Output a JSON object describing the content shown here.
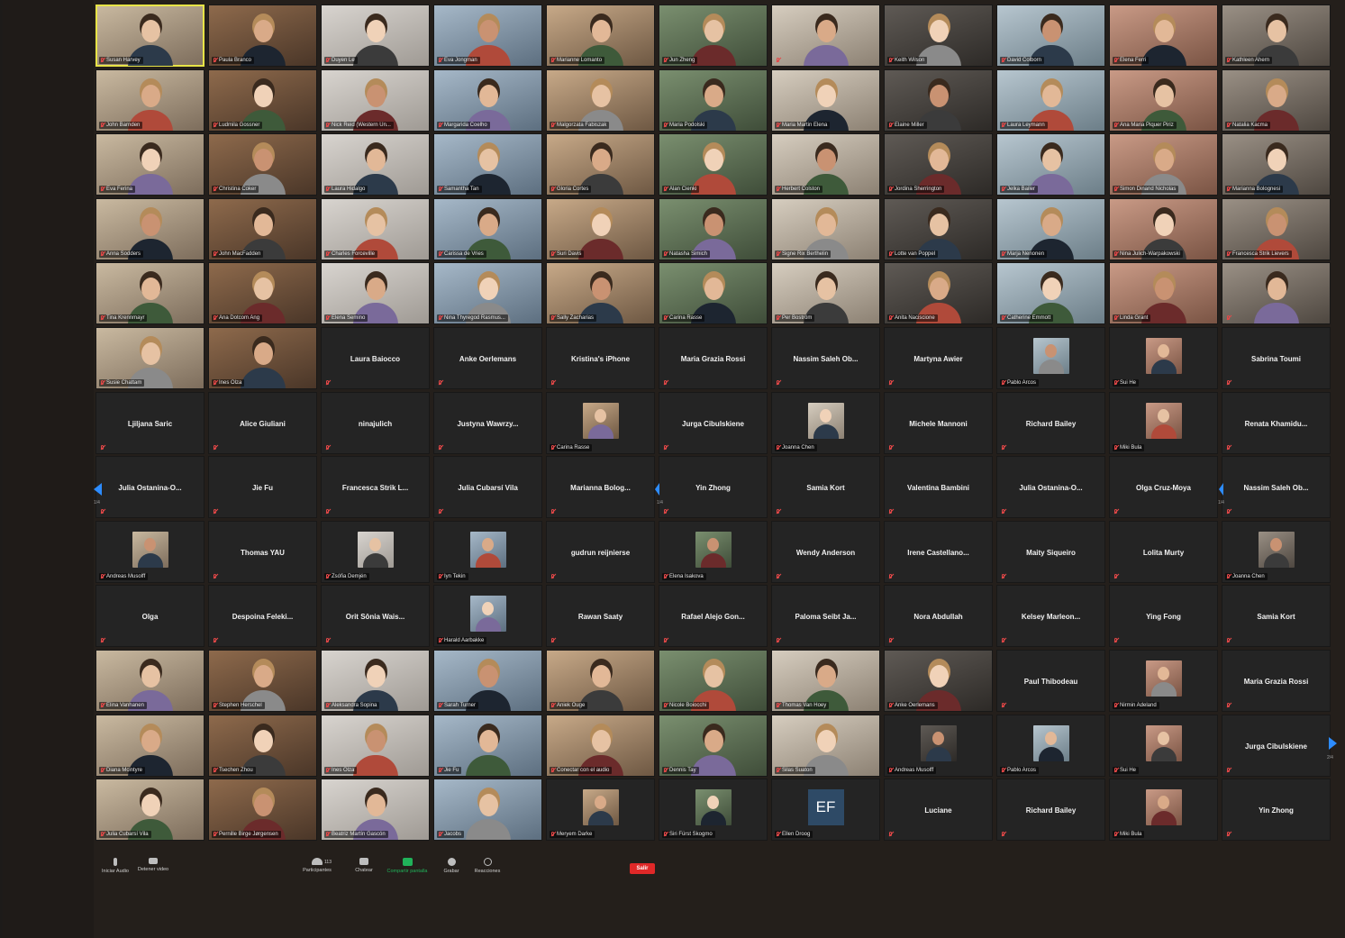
{
  "colors": {
    "background": "#241f1b",
    "tile": "#242424",
    "active_speaker": "#e7e447",
    "muted": "#e54848",
    "nav": "#2d8cff",
    "leave": "#e02828",
    "share": "#20b25a"
  },
  "icons": [
    "mic-muted-icon",
    "camera-icon",
    "participants-icon",
    "chat-icon",
    "share-screen-icon",
    "record-icon",
    "reactions-icon",
    "chevron-left-icon",
    "chevron-right-icon"
  ],
  "grid": {
    "rows": [
      [
        {
          "type": "video",
          "name": "Susan Harvey"
        },
        {
          "type": "video",
          "name": "Paula Branco"
        },
        {
          "type": "video",
          "name": "Duyen Le"
        },
        {
          "type": "video",
          "name": "Eva Jongman"
        },
        {
          "type": "video",
          "name": "Marianne Lomanto"
        },
        {
          "type": "video",
          "name": "Jun Zheng"
        },
        {
          "type": "video",
          "name": ""
        },
        {
          "type": "video",
          "name": "Keith Wilson"
        },
        {
          "type": "video",
          "name": "David Colborn"
        },
        {
          "type": "video",
          "name": "Elena Ferri"
        },
        {
          "type": "video",
          "name": "Kathleen Ahern"
        }
      ],
      [
        {
          "type": "video",
          "name": "John Barnden"
        },
        {
          "type": "video",
          "name": "Ludmila Gossner"
        },
        {
          "type": "video",
          "name": "Nick Reid (Western Un..."
        },
        {
          "type": "video",
          "name": "Margarida Coelho"
        },
        {
          "type": "video",
          "name": "Malgorzata Fabiszak"
        },
        {
          "type": "video",
          "name": "Maria Podolski"
        },
        {
          "type": "video",
          "name": "Maria Martin Elena"
        },
        {
          "type": "video",
          "name": "Elaine Miller"
        },
        {
          "type": "video",
          "name": "Laura Leymann"
        },
        {
          "type": "video",
          "name": "Ana Maria Piquer Piriz"
        },
        {
          "type": "video",
          "name": "Natalia Kacma"
        }
      ],
      [
        {
          "type": "video",
          "name": "Eva Ferina"
        },
        {
          "type": "video",
          "name": "Christina Coker"
        },
        {
          "type": "video",
          "name": "Laura Hidalgo"
        },
        {
          "type": "video",
          "name": "Samantha Tan"
        },
        {
          "type": "video",
          "name": "Gloria Cortes"
        },
        {
          "type": "video",
          "name": "Alan Cienki"
        },
        {
          "type": "video",
          "name": "Herbert Colston"
        },
        {
          "type": "video",
          "name": "Jordina Sherrington"
        },
        {
          "type": "video",
          "name": "Jelka Bailer"
        },
        {
          "type": "video",
          "name": "Simon Dinand Nicholas"
        },
        {
          "type": "video",
          "name": "Marianna Bolognesi"
        }
      ],
      [
        {
          "type": "video",
          "name": "Anna Sodders"
        },
        {
          "type": "video",
          "name": "John MacFadden"
        },
        {
          "type": "video",
          "name": "Charles Forceville"
        },
        {
          "type": "video",
          "name": "Carissa de Vries"
        },
        {
          "type": "video",
          "name": "Suri Davis"
        },
        {
          "type": "video",
          "name": "Natasha Simich"
        },
        {
          "type": "video",
          "name": "Signe Rix Berthelin"
        },
        {
          "type": "video",
          "name": "Lotte van Poppel"
        },
        {
          "type": "video",
          "name": "Marja Nenonen"
        },
        {
          "type": "video",
          "name": "Nina Julich-Warpakowski"
        },
        {
          "type": "video",
          "name": "Francesca Strik Lievers"
        }
      ],
      [
        {
          "type": "video",
          "name": "Tina Krennmayr"
        },
        {
          "type": "video",
          "name": "Ana Dotcom Ang"
        },
        {
          "type": "video",
          "name": "Elena Semino"
        },
        {
          "type": "video",
          "name": "Nina Thyregod Rasmus..."
        },
        {
          "type": "video",
          "name": "Sally Zacharias"
        },
        {
          "type": "video",
          "name": "Carina Rasse"
        },
        {
          "type": "video",
          "name": "Per Boström"
        },
        {
          "type": "video",
          "name": "Anita Naciscione"
        },
        {
          "type": "video",
          "name": "Catherine Emmott"
        },
        {
          "type": "video",
          "name": "Linda Grant"
        },
        {
          "type": "video",
          "name": ""
        }
      ],
      [
        {
          "type": "video",
          "name": "Susie Chattam"
        },
        {
          "type": "video",
          "name": "Ines Olza"
        },
        {
          "type": "name",
          "name": "Laura Baiocco"
        },
        {
          "type": "name",
          "name": "Anke Oerlemans"
        },
        {
          "type": "name",
          "name": "Kristina's iPhone"
        },
        {
          "type": "name",
          "name": "Maria Grazia Rossi"
        },
        {
          "type": "name",
          "name": "Nassim Saleh Ob..."
        },
        {
          "type": "name",
          "name": "Martyna Awier"
        },
        {
          "type": "photo",
          "name": "Pablo Arcos"
        },
        {
          "type": "photo",
          "name": "Sui He"
        },
        {
          "type": "name",
          "name": "Sabrina Toumi"
        }
      ],
      [
        {
          "type": "name",
          "name": "Ljiljana Saric"
        },
        {
          "type": "name",
          "name": "Alice Giuliani"
        },
        {
          "type": "name",
          "name": "ninajulich"
        },
        {
          "type": "name",
          "name": "Justyna Wawrzy..."
        },
        {
          "type": "photo",
          "name": "Carina Rasse"
        },
        {
          "type": "name",
          "name": "Jurga Cibulskiene"
        },
        {
          "type": "photo",
          "name": "Joanna Chen"
        },
        {
          "type": "name",
          "name": "Michele Mannoni"
        },
        {
          "type": "name",
          "name": "Richard Bailey"
        },
        {
          "type": "photo",
          "name": "Miki Bula"
        },
        {
          "type": "name",
          "name": "Renata Khamidu..."
        }
      ],
      [
        {
          "type": "name",
          "name": "Julia Ostanina-O..."
        },
        {
          "type": "name",
          "name": "Jie Fu"
        },
        {
          "type": "name",
          "name": "Francesca Strik L..."
        },
        {
          "type": "name",
          "name": "Julia Cubarsí Vila"
        },
        {
          "type": "name",
          "name": "Marianna Bolog..."
        },
        {
          "type": "name",
          "name": "Yin Zhong"
        },
        {
          "type": "name",
          "name": "Samia Kort"
        },
        {
          "type": "name",
          "name": "Valentina Bambini"
        },
        {
          "type": "name",
          "name": "Julia Ostanina-O..."
        },
        {
          "type": "name",
          "name": "Olga Cruz-Moya"
        },
        {
          "type": "name",
          "name": "Nassim Saleh Ob..."
        }
      ],
      [
        {
          "type": "photo",
          "name": "Andreas Musolff"
        },
        {
          "type": "name",
          "name": "Thomas YAU"
        },
        {
          "type": "photo",
          "name": "Zsófia Demjén"
        },
        {
          "type": "photo",
          "name": "Iyn Tekin"
        },
        {
          "type": "name",
          "name": "gudrun reijnierse"
        },
        {
          "type": "photo",
          "name": "Elena Isakova"
        },
        {
          "type": "name",
          "name": "Wendy Anderson"
        },
        {
          "type": "name",
          "name": "Irene Castellano..."
        },
        {
          "type": "name",
          "name": "Maity Siqueiro"
        },
        {
          "type": "name",
          "name": "Lolita Murty"
        },
        {
          "type": "photo",
          "name": "Joanna Chen"
        }
      ],
      [
        {
          "type": "name",
          "name": "Olga"
        },
        {
          "type": "name",
          "name": "Despoina Feleki..."
        },
        {
          "type": "name",
          "name": "Orit Sônia Wais..."
        },
        {
          "type": "photo",
          "name": "Harald Aarbakke"
        },
        {
          "type": "name",
          "name": "Rawan Saaty"
        },
        {
          "type": "name",
          "name": "Rafael Alejo Gon..."
        },
        {
          "type": "name",
          "name": "Paloma Seibt Ja..."
        },
        {
          "type": "name",
          "name": "Nora Abdullah"
        },
        {
          "type": "name",
          "name": "Kelsey Marleon..."
        },
        {
          "type": "name",
          "name": "Ying Fong"
        },
        {
          "type": "name",
          "name": "Samia Kort"
        }
      ],
      [
        {
          "type": "video",
          "name": "Elina Vanhanen"
        },
        {
          "type": "video",
          "name": "Stephen Herschel"
        },
        {
          "type": "video",
          "name": "Aleksandra Sopina"
        },
        {
          "type": "video",
          "name": "Sarah Turner"
        },
        {
          "type": "video",
          "name": "Aniek Ouge"
        },
        {
          "type": "video",
          "name": "Nicole Boiocchi"
        },
        {
          "type": "video",
          "name": "Thomas Van Hoey"
        },
        {
          "type": "video",
          "name": "Anke Oerlemans"
        },
        {
          "type": "name",
          "name": "Paul Thibodeau"
        },
        {
          "type": "photo",
          "name": "Nirmin Adeland"
        },
        {
          "type": "name",
          "name": "Maria Grazia Rossi"
        }
      ],
      [
        {
          "type": "video",
          "name": "Diana Mcintyre"
        },
        {
          "type": "video",
          "name": "Tsechen Zhou"
        },
        {
          "type": "video",
          "name": "Ines Olza"
        },
        {
          "type": "video",
          "name": "Jie Fu"
        },
        {
          "type": "video",
          "name": "Conectar con el audio"
        },
        {
          "type": "video",
          "name": "Dennis Tay"
        },
        {
          "type": "video",
          "name": "Silas Suaton"
        },
        {
          "type": "photo",
          "name": "Andreas Musolff"
        },
        {
          "type": "photo",
          "name": "Pablo Arcos"
        },
        {
          "type": "photo",
          "name": "Sui He"
        },
        {
          "type": "name",
          "name": "Jurga Cibulskiene"
        }
      ],
      [
        {
          "type": "video",
          "name": "Julia Cubarsí Vila"
        },
        {
          "type": "video",
          "name": "Pernille Birge Jørgensen"
        },
        {
          "type": "video",
          "name": "Beatriz Martín Gascón"
        },
        {
          "type": "video",
          "name": "Jacobs"
        },
        {
          "type": "photo",
          "name": "Meryem Darke"
        },
        {
          "type": "photo",
          "name": "Siri Fürst Skogmo"
        },
        {
          "type": "initials",
          "name": "Ellen Droog",
          "initials": "EF"
        },
        {
          "type": "name",
          "name": "Luciane"
        },
        {
          "type": "name",
          "name": "Richard Bailey"
        },
        {
          "type": "photo",
          "name": "Miki Bula"
        },
        {
          "type": "name",
          "name": "Yin Zhong"
        }
      ]
    ]
  },
  "paging": {
    "left_page": "1/4",
    "right_page": "2/4",
    "mid_page": "1/4",
    "right_edge_page": "1/4"
  },
  "toolbar": {
    "audio_label": "Iniciar Audio",
    "video_label": "Detener video",
    "participants_label": "Participantes",
    "participants_count": "113",
    "chat_label": "Chatear",
    "share_label": "Compartir pantalla",
    "record_label": "Grabar",
    "reactions_label": "Reacciones",
    "leave_label": "Salir"
  }
}
